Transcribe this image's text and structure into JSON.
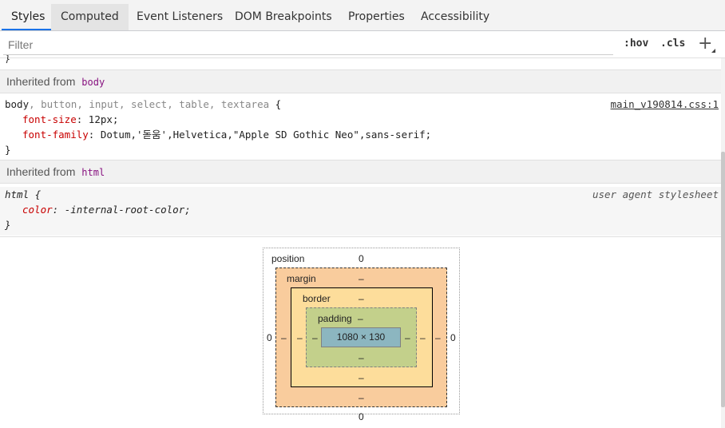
{
  "tabs": [
    {
      "label": "Styles"
    },
    {
      "label": "Computed"
    },
    {
      "label": "Event Listeners"
    },
    {
      "label": "DOM Breakpoints"
    },
    {
      "label": "Properties"
    },
    {
      "label": "Accessibility"
    }
  ],
  "filter": {
    "placeholder": "Filter",
    "hov": ":hov",
    "cls": ".cls",
    "plus": "+"
  },
  "inherited": [
    {
      "prefix": "Inherited from",
      "tag": "body"
    },
    {
      "prefix": "Inherited from",
      "tag": "html"
    }
  ],
  "rules": [
    {
      "selector_main": "body",
      "selector_rest": ", button, input, select, table, textarea",
      "open": " {",
      "source": "main_v190814.css:1",
      "props": [
        {
          "name": "font-size",
          "value": "12px;"
        },
        {
          "name": "font-family",
          "value": "Dotum,'돋움',Helvetica,\"Apple SD Gothic Neo\",sans-serif;"
        }
      ],
      "close": "}"
    },
    {
      "selector_main": "html",
      "open": " {",
      "source": "user agent stylesheet",
      "props": [
        {
          "name": "color",
          "value": "-internal-root-color;"
        }
      ],
      "close": "}"
    }
  ],
  "box_model": {
    "position_label": "position",
    "position_top": "0",
    "position_left": "0",
    "position_right": "0",
    "position_bottom": "0",
    "margin_label": "margin",
    "margin_top": "–",
    "margin_left": "–",
    "margin_right": "–",
    "margin_bottom": "–",
    "border_label": "border",
    "border_top": "–",
    "border_left": "–",
    "border_right": "–",
    "border_bottom": "–",
    "padding_label": "padding",
    "padding_top": "–",
    "padding_left": "–",
    "padding_right": "–",
    "padding_bottom": "–",
    "content": "1080 × 130"
  }
}
